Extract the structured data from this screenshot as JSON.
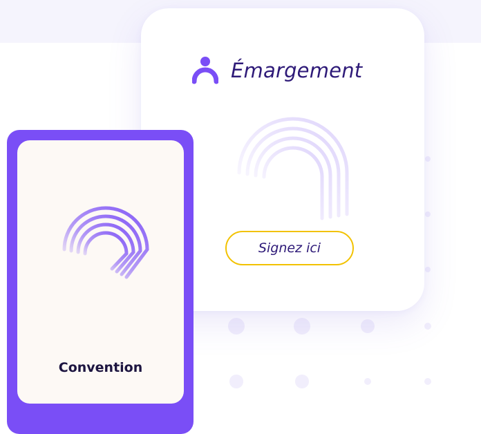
{
  "signature_card": {
    "title": "Émargement",
    "icon": "user-icon",
    "sign_button_label": "Signez ici"
  },
  "convention_card": {
    "title": "Convention",
    "icon": "arch-rings-icon"
  },
  "colors": {
    "accent_purple": "#7a4ef6",
    "dark_text": "#2e1a78",
    "button_border_yellow": "#f2c200",
    "band_background": "#f5f4fd",
    "card_cream": "#fdf9f5"
  }
}
